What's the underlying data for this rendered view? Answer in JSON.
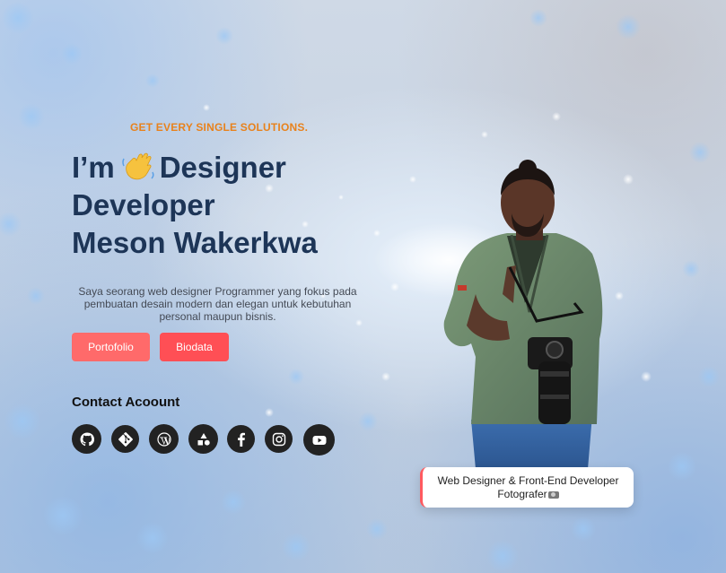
{
  "hero": {
    "eyebrow": "GET EVERY SINGLE SOLUTIONS.",
    "heading_lines": [
      "I’m",
      "Designer",
      "Developer",
      "Meson Wakerkwa"
    ],
    "intro": "Saya seorang web designer Programmer yang fokus pada pembuatan desain modern dan elegan untuk kebutuhan personal maupun bisnis.",
    "buttons": {
      "portfolio": "Portofolio",
      "biodata": "Biodata"
    }
  },
  "contact": {
    "title": "Contact Acoount",
    "icons": [
      "github-icon",
      "git-icon",
      "wordpress-icon",
      "shapes-icon",
      "facebook-icon",
      "instagram-icon",
      "youtube-icon"
    ]
  },
  "role_card": {
    "line1": "Web Designer & Front-End Developer",
    "line2": "Fotografer"
  },
  "colors": {
    "accent": "#ff5a5f",
    "eyebrow": "#e8821c",
    "heading": "#1d3557"
  }
}
